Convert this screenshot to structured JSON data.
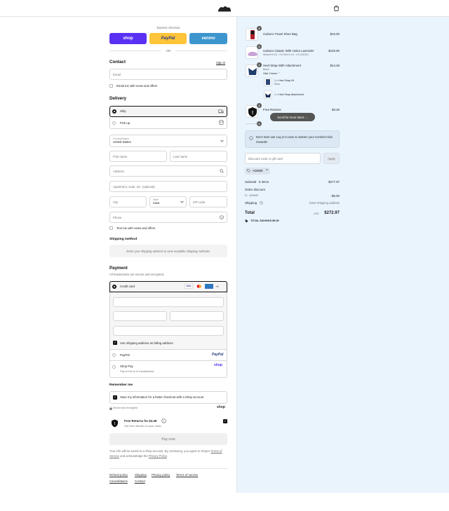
{
  "header": {
    "logo": "Calzuro logo",
    "cart_icon": "bag-icon"
  },
  "express": {
    "label": "Express checkout",
    "shop": "shop",
    "paypal": "PayPal",
    "venmo": "venmo",
    "or": "OR"
  },
  "contact": {
    "heading": "Contact",
    "signin": "Sign in",
    "email_placeholder": "Email",
    "news_label": "Email me with news and offers"
  },
  "delivery": {
    "heading": "Delivery",
    "ship": "Ship",
    "pickup": "Pick up",
    "country_label": "Country/Region",
    "country_value": "United States",
    "first_name": "First name",
    "last_name": "Last name",
    "address": "Address",
    "apartment": "Apartment, suite, etc. (optional)",
    "city": "City",
    "state_label": "State",
    "state_value": "Iowa",
    "zip": "ZIP code",
    "phone": "Phone",
    "text_label": "Text me with news and offers"
  },
  "shipping_method": {
    "heading": "Shipping method",
    "placeholder": "Enter your shipping address to view available shipping methods."
  },
  "payment": {
    "heading": "Payment",
    "subtitle": "All transactions are secure and encrypted.",
    "credit_card": "Credit card",
    "more_cards": "+4",
    "use_shipping": "Use shipping address as billing address",
    "paypal": "PayPal",
    "paypal_logo": "PayPal",
    "shoppay": "Shop Pay",
    "shoppay_sub": "Pay in full or in installments",
    "shoppay_logo": "shop"
  },
  "remember": {
    "heading": "Remember me",
    "save_label": "Save my information for a faster checkout with a Shop account",
    "secure": "Secure and encrypted",
    "shop_logo": "shop"
  },
  "free_returns": {
    "title": "Free Returns for $3.49",
    "sub": "Get free returns on your order"
  },
  "pay_now": "Pay now",
  "legal": {
    "prefix": "Your info will be saved to a Shop account. By continuing, you agree to Shop's ",
    "tos": "Terms of Service",
    "mid": " and acknowledge the ",
    "privacy": "Privacy Policy",
    "end": "."
  },
  "footer": {
    "links": [
      "Refund policy",
      "Shipping",
      "Privacy policy",
      "Terms of service",
      "Cancellations",
      "Contact"
    ]
  },
  "cart": {
    "items": [
      {
        "qty": "1",
        "name": "Calzuro Travel Shoe Bag",
        "price": "$15.00"
      },
      {
        "qty": "1",
        "name": "Calzuro Classic With Holes Lavender",
        "variant": "Women's 5.5 - 6.5 Men's 4.5 - 4.5 (34/35 )",
        "price": "$125.00"
      },
      {
        "qty": "1",
        "name": "Heel Strap With Attachment",
        "variant": "Black",
        "hide": "Hide 2 items",
        "price": "$14.48",
        "sub": [
          {
            "name": "1 × Heel Strap Kit",
            "variant": "Black"
          },
          {
            "name": "1 × Heel Strap Attachment"
          }
        ]
      },
      {
        "qty": "1",
        "name": "Free Returns",
        "price": "$3.49"
      }
    ],
    "next_qty": "1",
    "scroll_hint": "Scroll for more items",
    "notice": "Don't miss out! Log in to earn & redeem your Comfort Club rewards!",
    "discount_placeholder": "Discount code or gift card",
    "apply": "Apply",
    "code_tag": "ADBME",
    "subtotal_label": "Subtotal · 5 items",
    "subtotal_value": "$277.97",
    "order_discount_label": "Order discount",
    "discount_code": "ADBME",
    "discount_value": "−$5.00",
    "shipping_label": "Shipping",
    "shipping_value": "Enter shipping address",
    "total_label": "Total",
    "currency": "USD",
    "total_value": "$272.97",
    "savings_label": "TOTAL SAVINGS",
    "savings_value": "$5.00"
  },
  "colors": {
    "shop": "#5a31f4",
    "paypal": "#ffc439",
    "venmo": "#3d95ce",
    "rightpane": "#eaf4fd"
  }
}
